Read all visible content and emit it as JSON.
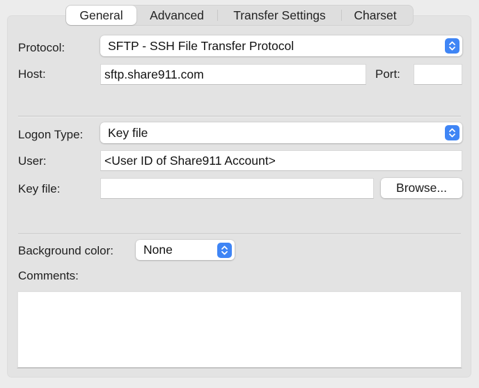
{
  "tabs": [
    {
      "label": "General",
      "active": true
    },
    {
      "label": "Advanced",
      "active": false
    },
    {
      "label": "Transfer Settings",
      "active": false
    },
    {
      "label": "Charset",
      "active": false
    }
  ],
  "server": {
    "protocol_label": "Protocol:",
    "protocol_value": "SFTP - SSH File Transfer Protocol",
    "host_label": "Host:",
    "host_value": "sftp.share911.com",
    "port_label": "Port:",
    "port_value": ""
  },
  "logon": {
    "logon_type_label": "Logon Type:",
    "logon_type_value": "Key file",
    "user_label": "User:",
    "user_value": "<User ID of Share911 Account>",
    "key_file_label": "Key file:",
    "key_file_value": "",
    "browse_label": "Browse..."
  },
  "misc": {
    "bg_color_label": "Background color:",
    "bg_color_value": "None",
    "comments_label": "Comments:",
    "comments_value": ""
  },
  "colors": {
    "accent": "#3f85f5",
    "panel_bg": "#e3e3e3",
    "window_bg": "#ececec"
  }
}
